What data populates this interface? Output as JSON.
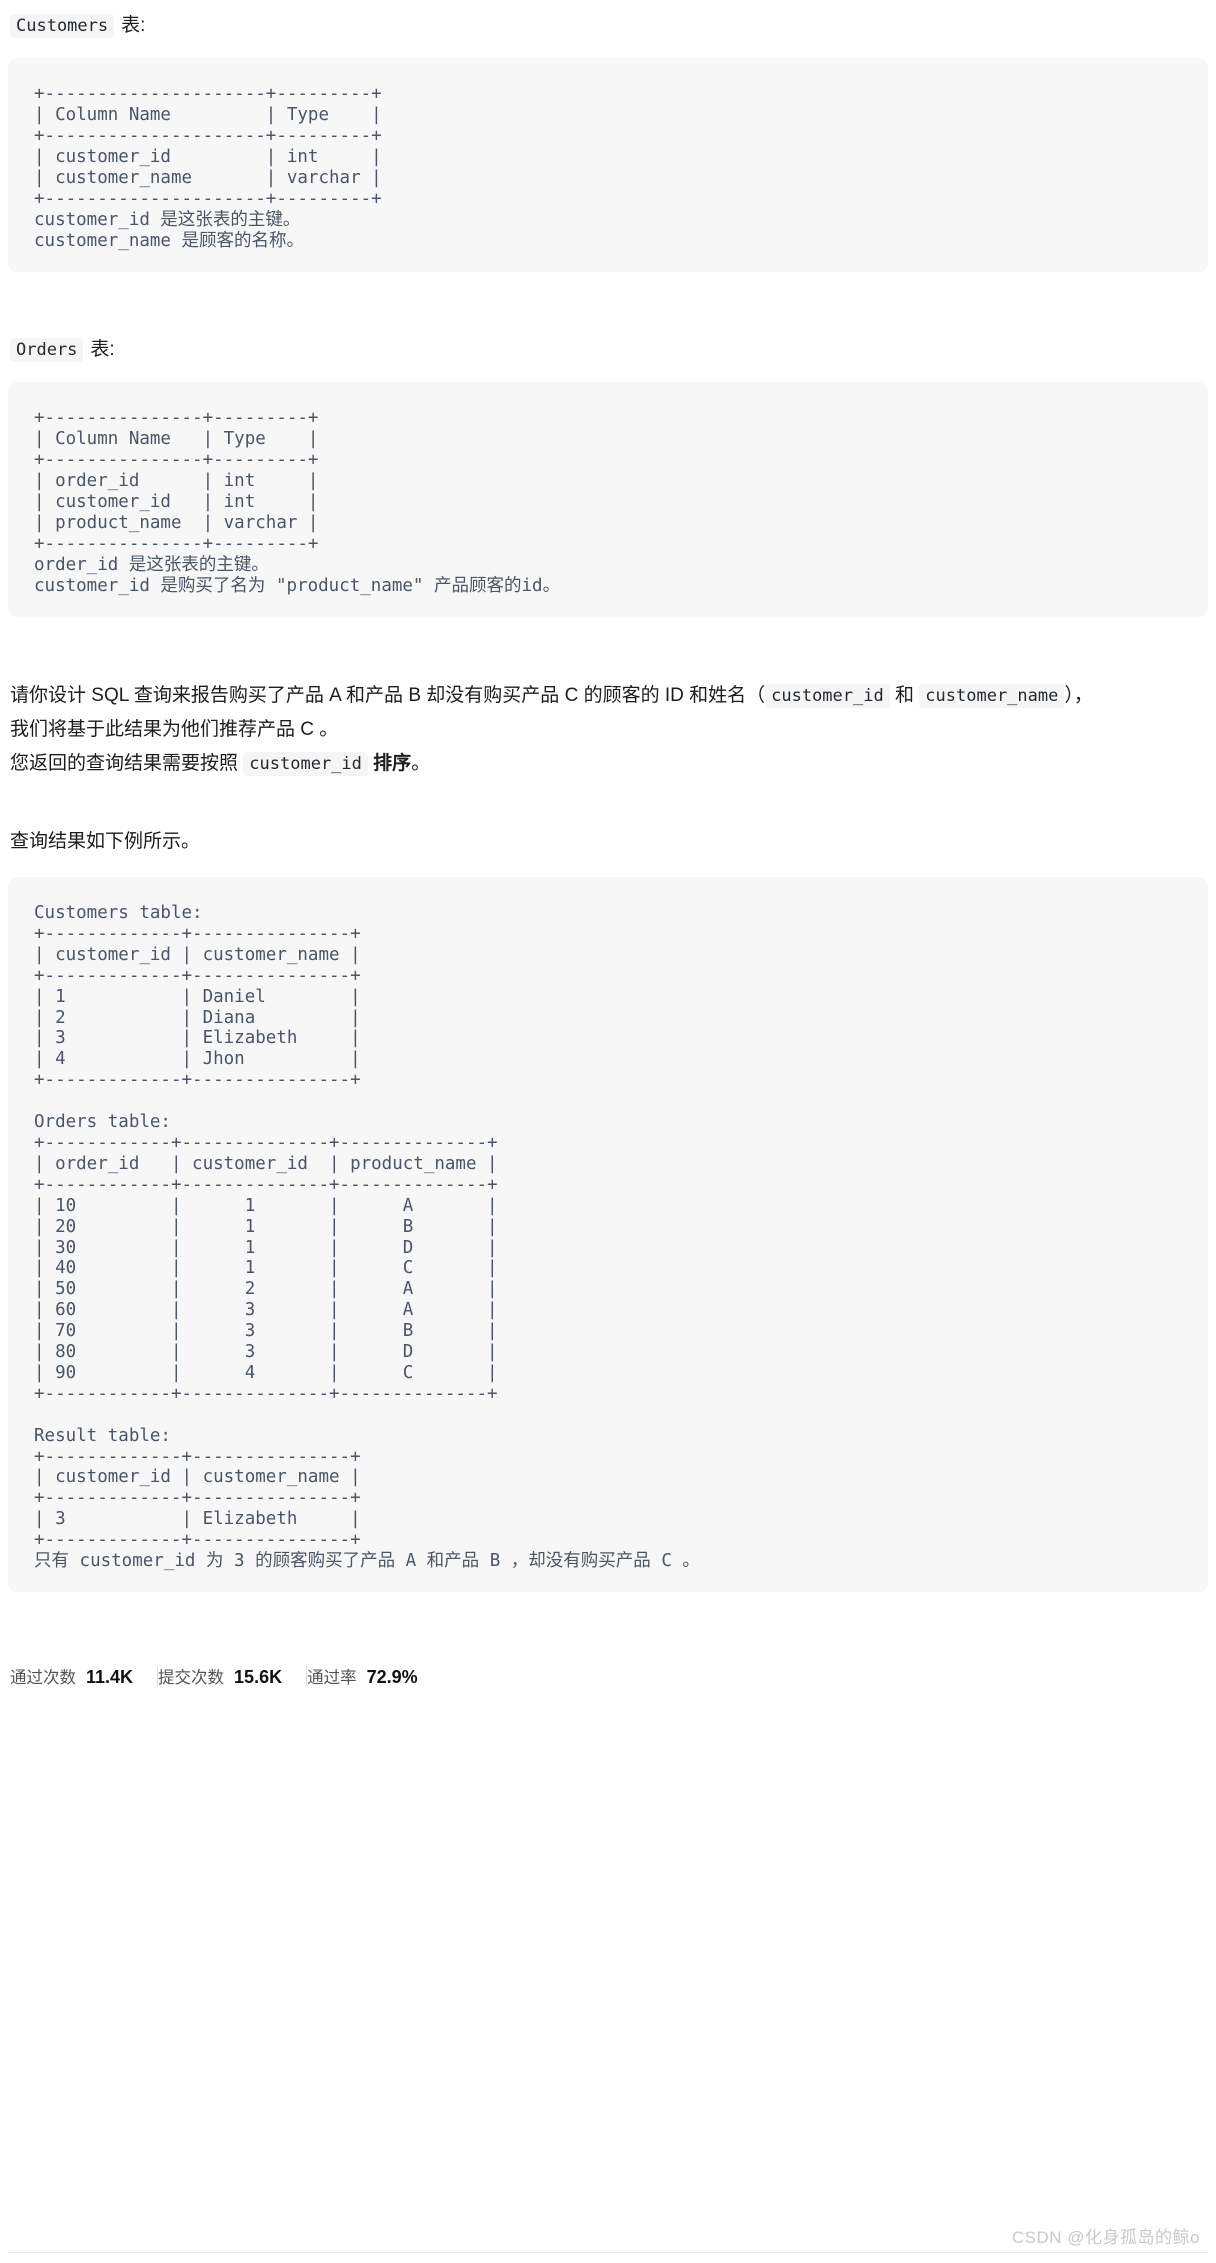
{
  "sections": {
    "customers_caption": {
      "code": "Customers",
      "tail": "表:"
    },
    "orders_caption": {
      "code": "Orders",
      "tail": "表:"
    },
    "customers_schema_block": "+---------------------+---------+\n| Column Name         | Type    |\n+---------------------+---------+\n| customer_id         | int     |\n| customer_name       | varchar |\n+---------------------+---------+\ncustomer_id 是这张表的主键。\ncustomer_name 是顾客的名称。",
    "orders_schema_block": "+---------------+---------+\n| Column Name   | Type    |\n+---------------+---------+\n| order_id      | int     |\n| customer_id   | int     |\n| product_name  | varchar |\n+---------------+---------+\norder_id 是这张表的主键。\ncustomer_id 是购买了名为 \"product_name\" 产品顾客的id。",
    "example_block": "Customers table:\n+-------------+---------------+\n| customer_id | customer_name |\n+-------------+---------------+\n| 1           | Daniel        |\n| 2           | Diana         |\n| 3           | Elizabeth     |\n| 4           | Jhon          |\n+-------------+---------------+\n\nOrders table:\n+------------+--------------+--------------+\n| order_id   | customer_id  | product_name |\n+------------+--------------+--------------+\n| 10         |      1       |      A       |\n| 20         |      1       |      B       |\n| 30         |      1       |      D       |\n| 40         |      1       |      C       |\n| 50         |      2       |      A       |\n| 60         |      3       |      A       |\n| 70         |      3       |      B       |\n| 80         |      3       |      D       |\n| 90         |      4       |      C       |\n+------------+--------------+--------------+\n\nResult table:\n+-------------+---------------+\n| customer_id | customer_name |\n+-------------+---------------+\n| 3           | Elizabeth     |\n+-------------+---------------+\n只有 customer_id 为 3 的顾客购买了产品 A 和产品 B ，却没有购买产品 C 。"
  },
  "question": {
    "line1_part1": "请你设计 SQL 查询来报告购买了产品 A 和产品 B 却没有购买产品 C 的顾客的 ID 和姓名（",
    "chip1": "customer_id",
    "between_chips": "和",
    "chip2": "customer_name",
    "line1_part2": "），",
    "line2": "我们将基于此结果为他们推荐产品 C 。",
    "line3_part1": "您返回的查询结果需要按照",
    "chip3": "customer_id",
    "line3_bold": "排序",
    "line3_part2": "。"
  },
  "example_intro": "查询结果如下例所示。",
  "stats": [
    {
      "label": "通过次数",
      "value": "11.4K"
    },
    {
      "label": "提交次数",
      "value": "15.6K"
    },
    {
      "label": "通过率",
      "value": "72.9%"
    }
  ],
  "watermark": "CSDN @化身孤岛的鲸o",
  "colors": {
    "code_bg": "#f7f7f8",
    "chip_bg": "#f5f5f5",
    "code_text": "#4b5563",
    "body_text": "#1d1d1f",
    "watermark": "#c9c9c9"
  }
}
